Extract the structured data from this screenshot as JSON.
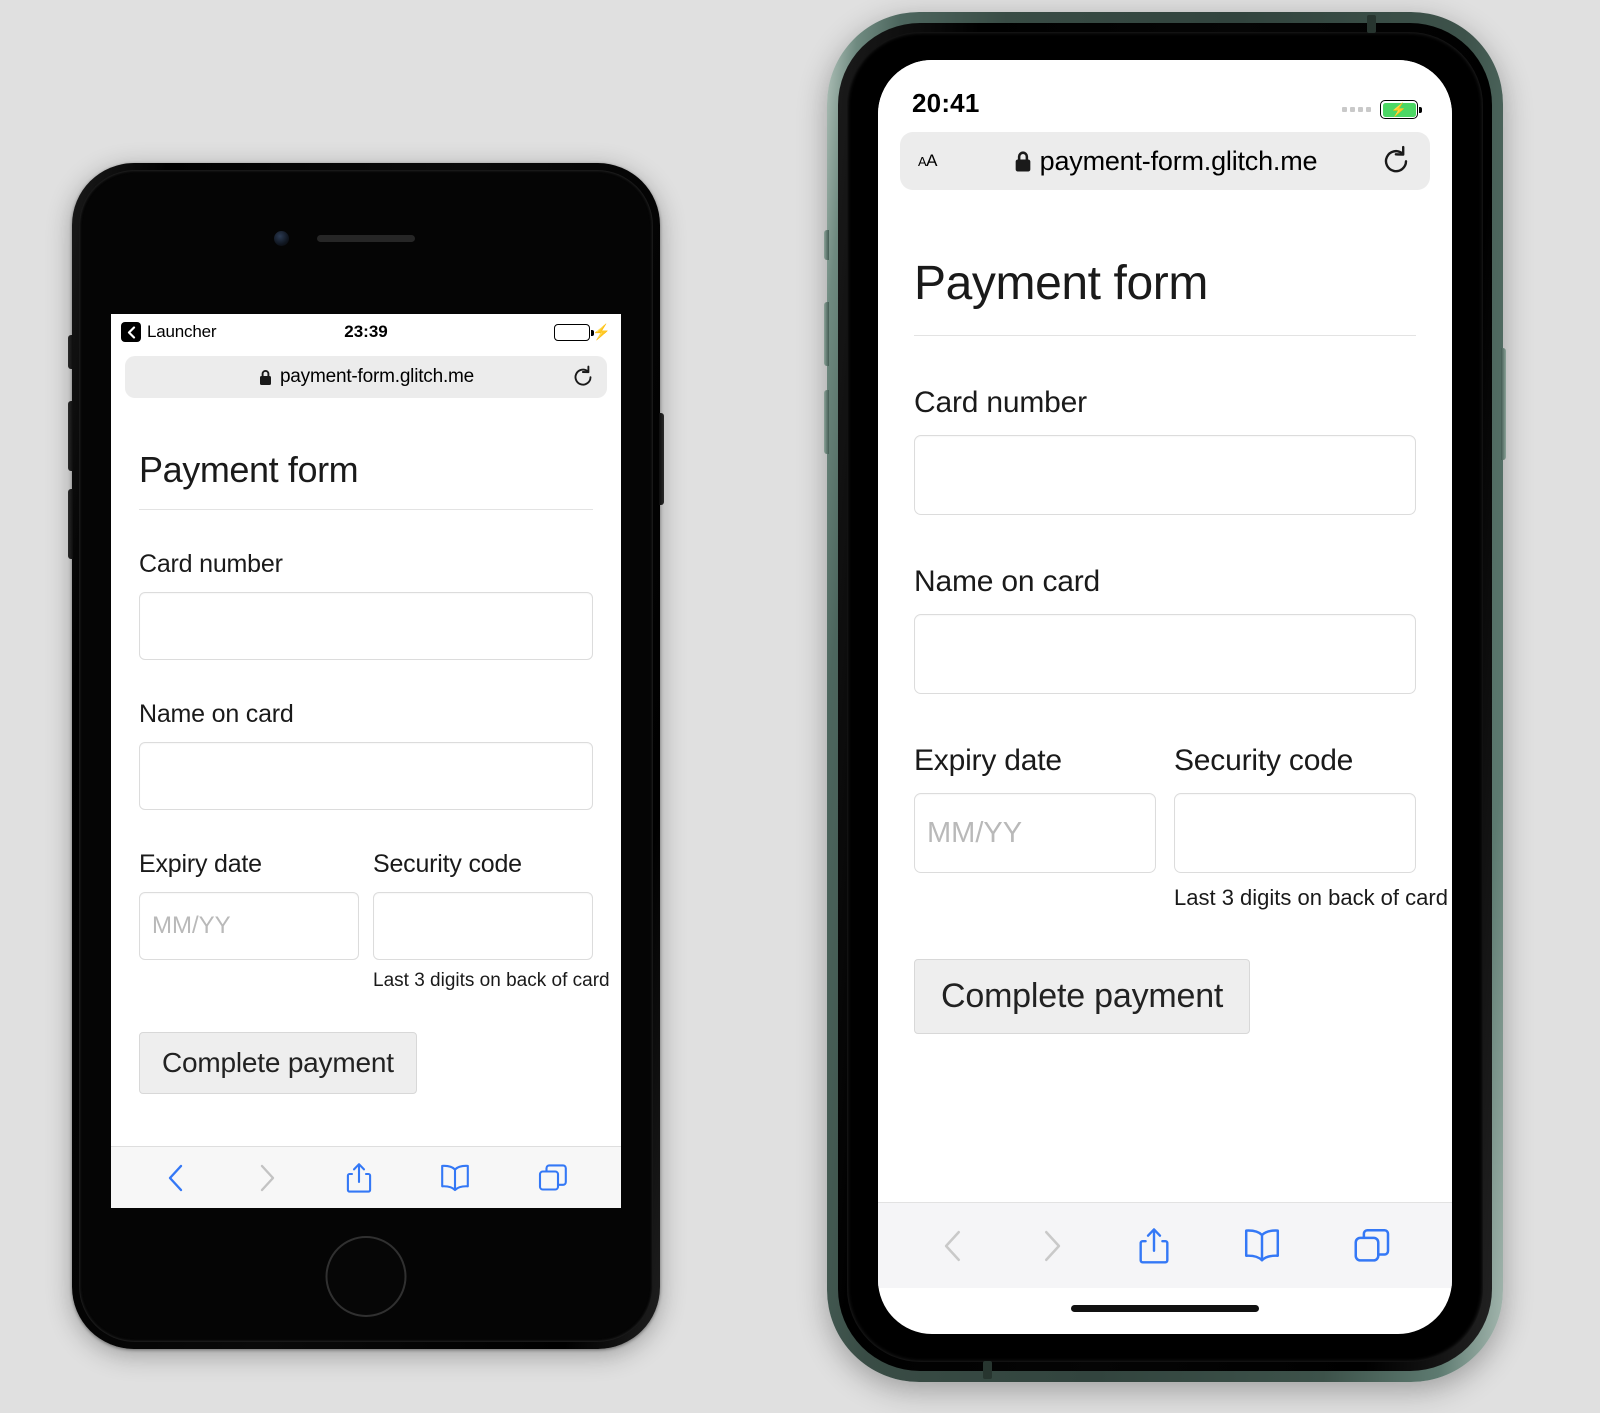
{
  "background_color": "#e0e0e0",
  "accent_color": "#3478f6",
  "battery_color": "#4cd764",
  "phones": [
    {
      "id": "left",
      "model_style": "home-button",
      "frame_color": "#000000",
      "status_bar": {
        "back_label": "Launcher",
        "back_icon": "chevron-left-icon",
        "time": "23:39",
        "battery_icon": "battery-icon",
        "charging_icon": "lightning-bolt-icon"
      },
      "browser": {
        "url": "payment-form.glitch.me",
        "lock_icon": "lock-icon",
        "reload_icon": "reload-icon"
      },
      "toolbar": {
        "back_icon": "back-chevron-icon",
        "forward_icon": "forward-chevron-icon",
        "share_icon": "share-icon",
        "bookmarks_icon": "book-icon",
        "tabs_icon": "tabs-icon"
      },
      "page": {
        "title": "Payment form",
        "fields": [
          {
            "label": "Card number",
            "value": "",
            "placeholder": ""
          },
          {
            "label": "Name on card",
            "value": "",
            "placeholder": ""
          }
        ],
        "expiry": {
          "label": "Expiry date",
          "value": "",
          "placeholder": "MM/YY"
        },
        "security": {
          "label": "Security code",
          "value": "",
          "placeholder": ""
        },
        "hint": "Last 3 digits on back of card",
        "submit_label": "Complete payment"
      }
    },
    {
      "id": "right",
      "model_style": "notch",
      "frame_color": "#32443e",
      "status_bar": {
        "time": "20:41",
        "signal_icon": "signal-dots-icon",
        "battery_icon": "battery-charging-icon"
      },
      "browser": {
        "text_size_label": "AA",
        "url": "payment-form.glitch.me",
        "lock_icon": "lock-icon",
        "reload_icon": "reload-icon"
      },
      "toolbar": {
        "back_icon": "back-chevron-icon",
        "forward_icon": "forward-chevron-icon",
        "share_icon": "share-icon",
        "bookmarks_icon": "book-icon",
        "tabs_icon": "tabs-icon"
      },
      "page": {
        "title": "Payment form",
        "fields": [
          {
            "label": "Card number",
            "value": "",
            "placeholder": ""
          },
          {
            "label": "Name on card",
            "value": "",
            "placeholder": ""
          }
        ],
        "expiry": {
          "label": "Expiry date",
          "value": "",
          "placeholder": "MM/YY"
        },
        "security": {
          "label": "Security code",
          "value": "",
          "placeholder": ""
        },
        "hint": "Last 3 digits on back of card",
        "submit_label": "Complete payment"
      }
    }
  ]
}
